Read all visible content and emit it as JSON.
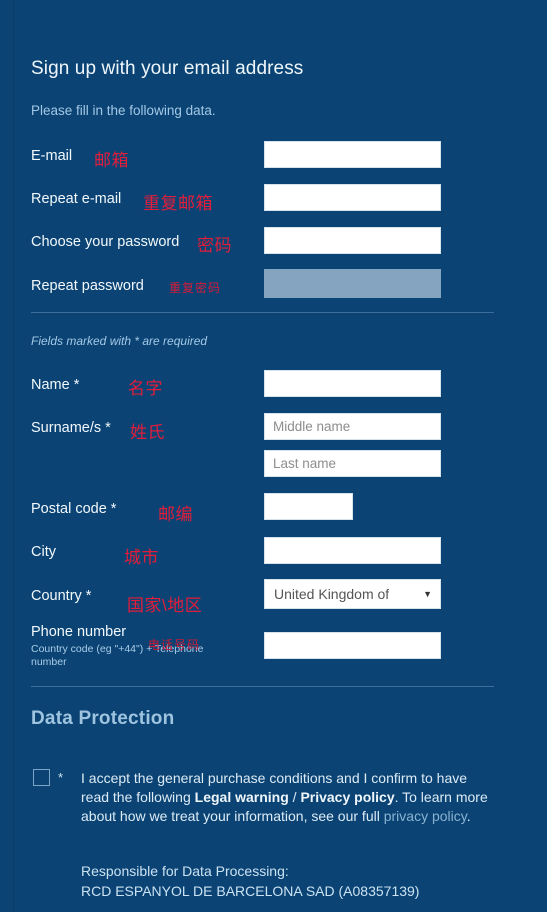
{
  "theme": {
    "background": "#0b4474",
    "input_bg": "#ffffff",
    "input_disabled_bg": "#84a4c0",
    "annotation_color": "#e11d3c",
    "heading_color": "#9ec4e0",
    "muted_text": "#a3c8e6"
  },
  "form": {
    "title": "Sign up with your email address",
    "subtitle": "Please fill in the following data.",
    "required_note": "Fields marked with * are required",
    "fields": [
      {
        "id": "email",
        "label": "E-mail",
        "annotation_cn": "邮箱",
        "value": "",
        "placeholder": "",
        "disabled": false
      },
      {
        "id": "repeat-email",
        "label": "Repeat e-mail",
        "annotation_cn": "重复邮箱",
        "value": "",
        "placeholder": "",
        "disabled": false
      },
      {
        "id": "password",
        "label": "Choose your password",
        "annotation_cn": "密码",
        "value": "",
        "placeholder": "",
        "disabled": false
      },
      {
        "id": "repeat-password",
        "label": "Repeat password",
        "annotation_cn": "重复密码",
        "value": "",
        "placeholder": "",
        "disabled": true
      },
      {
        "id": "name",
        "label": "Name *",
        "annotation_cn": "名字",
        "value": "",
        "placeholder": "",
        "disabled": false
      },
      {
        "id": "middle-name",
        "label": "Surname/s *",
        "annotation_cn": "姓氏",
        "value": "",
        "placeholder": "Middle name",
        "disabled": false
      },
      {
        "id": "last-name",
        "label": "",
        "annotation_cn": "",
        "value": "",
        "placeholder": "Last name",
        "disabled": false
      },
      {
        "id": "postal-code",
        "label": "Postal code *",
        "annotation_cn": "邮编",
        "value": "",
        "placeholder": "",
        "disabled": false
      },
      {
        "id": "city",
        "label": "City",
        "annotation_cn": "城市",
        "value": "",
        "placeholder": "",
        "disabled": false
      },
      {
        "id": "country",
        "label": "Country *",
        "annotation_cn": "国家\\地区",
        "value": "United Kingdom of",
        "placeholder": "",
        "disabled": false
      },
      {
        "id": "phone",
        "label": "Phone number",
        "sublabel": "Country code (eg \"+44\") + Telephone number",
        "annotation_cn": "电话号码",
        "value": "",
        "placeholder": "",
        "disabled": false
      }
    ],
    "country_selected": "United Kingdom of",
    "country_caret": "▼"
  },
  "data_protection": {
    "title": "Data Protection",
    "required_marker": "*",
    "consent_part1": "I accept the general purchase conditions and I confirm to have read the following ",
    "consent_link1": "Legal warning",
    "consent_sep": " / ",
    "consent_link2": "Privacy policy",
    "consent_part2": ". To learn more about how we treat your information, see our full ",
    "consent_link3": "privacy policy",
    "consent_part3": ".",
    "responsible_line1": "Responsible for Data Processing:",
    "responsible_line2": "RCD ESPANYOL DE BARCELONA SAD (A08357139)"
  }
}
